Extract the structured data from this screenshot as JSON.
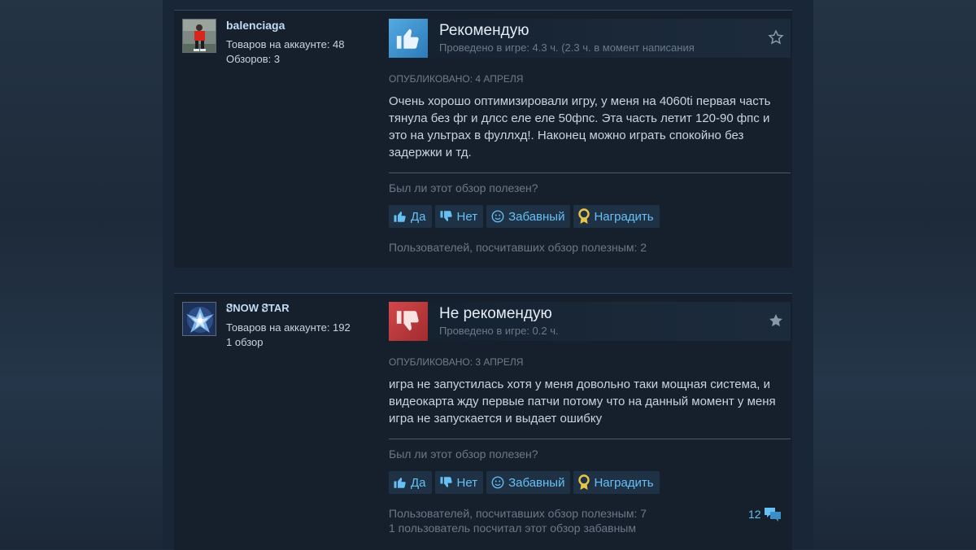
{
  "reviews": [
    {
      "author": "balenciaga",
      "products_label": "Товаров на аккаунте: 48",
      "reviews_label": "Обзоров: 3",
      "verdict": "Рекомендую",
      "playtime": "Проведено в игре: 4.3 ч. (2.3 ч. в момент написания",
      "posted": "Опубликовано: 4 апреля",
      "body": "Очень хорошо оптимизировали игру, у меня на 4060ti первая часть тянула без фг и длсс еле еле 50фпс. Эта часть летит 120-90 фпс и это на ультрах в фуллхд!. Наконец можно играть спокойно без задержки и тд.",
      "helpful_question": "Был ли этот обзор полезен?",
      "yes_label": "Да",
      "no_label": "Нет",
      "funny_label": "Забавный",
      "award_label": "Наградить",
      "helpful_stat": "Пользователей, посчитавших обзор полезным: 2",
      "funny_stat": "",
      "comments": ""
    },
    {
      "author": "ꗟNOW ꗟTAR",
      "products_label": "Товаров на аккаунте: 192",
      "reviews_label": "1 обзор",
      "verdict": "Не рекомендую",
      "playtime": "Проведено в игре: 0.2 ч.",
      "posted": "Опубликовано: 3 апреля",
      "body": "игра не запустилась хотя у меня довольно таки мощная система, и видеокарта жду первые патчи потому что на данный момент у меня игра не запускается и выдает ошибку",
      "helpful_question": "Был ли этот обзор полезен?",
      "yes_label": "Да",
      "no_label": "Нет",
      "funny_label": "Забавный",
      "award_label": "Наградить",
      "helpful_stat": "Пользователей, посчитавших обзор полезным: 7",
      "funny_stat": "1 пользователь посчитал этот обзор забавным",
      "comments": "12"
    }
  ],
  "colors": {
    "accent_link": "#66c0f4",
    "thumb_up": "#3f8ecb",
    "thumb_down": "#c0393b"
  },
  "icons": [
    "thumbs-up-icon",
    "thumbs-down-icon",
    "smiley-icon",
    "award-icon",
    "star-icon",
    "comment-icon"
  ]
}
